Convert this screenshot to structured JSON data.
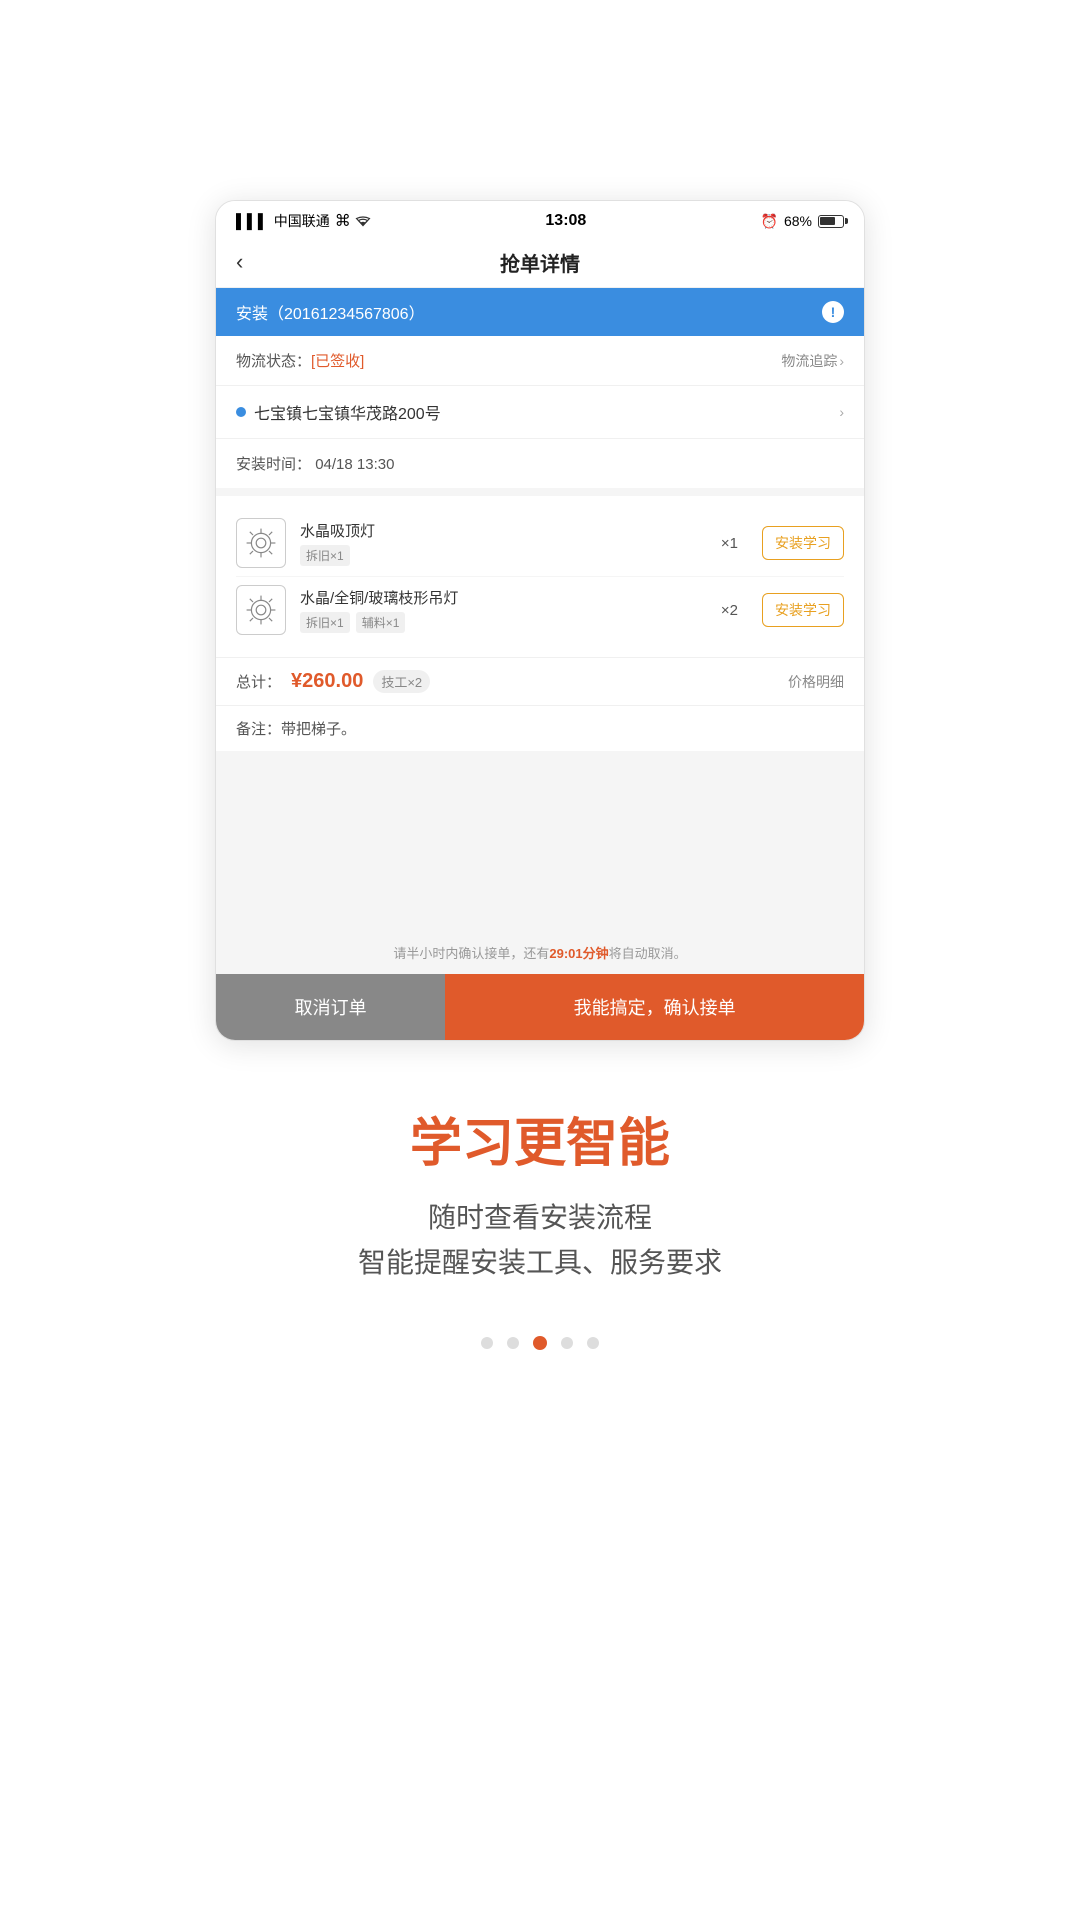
{
  "status_bar": {
    "signal": "▌▌▌",
    "carrier": "中国联通",
    "wifi": "WiFi",
    "time": "13:08",
    "alarm": "⏰",
    "battery_pct": "68%"
  },
  "header": {
    "back_label": "‹",
    "title": "抢单详情"
  },
  "order_banner": {
    "text": "安装（20161234567806）",
    "exclamation": "!"
  },
  "logistics": {
    "label": "物流状态：",
    "status": "[已签收]",
    "track_label": "物流追踪",
    "chevron": "›"
  },
  "address": {
    "text": "七宝镇七宝镇华茂路200号",
    "chevron": "›"
  },
  "install_time": {
    "label": "安装时间：",
    "value": "04/18 13:30"
  },
  "products": [
    {
      "name": "水晶吸顶灯",
      "tags": [
        "拆旧×1"
      ],
      "qty": "×1",
      "btn_label": "安装学习"
    },
    {
      "name": "水晶/全铜/玻璃枝形吊灯",
      "tags": [
        "拆旧×1",
        "辅料×1"
      ],
      "qty": "×2",
      "btn_label": "安装学习"
    }
  ],
  "total": {
    "label": "总计：",
    "price": "¥260.00",
    "worker_badge": "技工×2",
    "detail_label": "价格明细"
  },
  "note": {
    "label": "备注：带把梯子。"
  },
  "timer": {
    "text_before": "请半小时内确认接单，还有",
    "time": "29:01分钟",
    "text_after": "将自动取消。"
  },
  "buttons": {
    "cancel": "取消订单",
    "confirm": "我能搞定，确认接单"
  },
  "bottom": {
    "headline": "学习更智能",
    "subtitle_line1": "随时查看安装流程",
    "subtitle_line2": "智能提醒安装工具、服务要求"
  },
  "pagination": {
    "total": 5,
    "active_index": 2
  }
}
